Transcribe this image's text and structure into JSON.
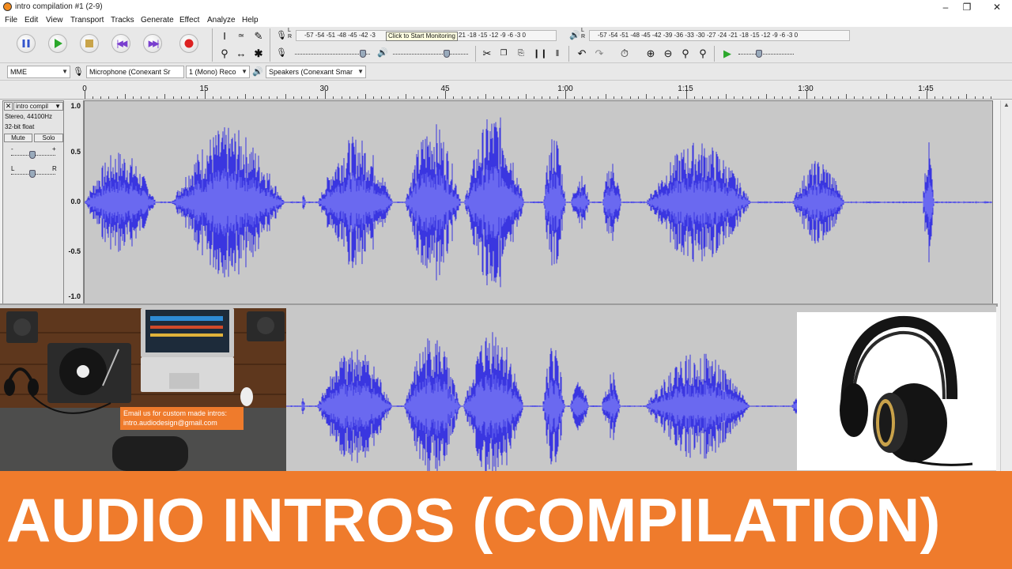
{
  "window": {
    "title": "intro compilation #1 (2-9)",
    "minimize_label": "–",
    "maximize_label": "❐",
    "close_label": "✕"
  },
  "menu": [
    "File",
    "Edit",
    "View",
    "Transport",
    "Tracks",
    "Generate",
    "Effect",
    "Analyze",
    "Help"
  ],
  "transport": {
    "buttons": [
      "pause-icon",
      "play-icon",
      "stop-icon",
      "skip-to-start-icon",
      "skip-to-end-icon",
      "record-icon"
    ]
  },
  "meters": {
    "record_channels": "L\nR",
    "record_scale": "-57 -54 -51 -48 -45 -42 -3",
    "record_scale_tail": "21 -18 -15 -12  -9  -6  -3  0",
    "monitor_tooltip": "Click to Start Monitoring",
    "playback_scale": "-57 -54 -51 -48 -45 -42 -39 -36 -33 -30 -27 -24 -21 -18 -15 -12  -9  -6  -3  0"
  },
  "devices": {
    "host": "MME",
    "input": "Microphone (Conexant Sr",
    "channels": "1 (Mono) Reco",
    "output": "Speakers (Conexant Smar"
  },
  "ruler": {
    "labels": [
      "0",
      "15",
      "30",
      "45",
      "1:00",
      "1:15",
      "1:30",
      "1:45"
    ]
  },
  "track": {
    "name": "intro compil",
    "format": "Stereo, 44100Hz",
    "bits": "32-bit float",
    "mute_label": "Mute",
    "solo_label": "Solo",
    "gain_minus": "-",
    "gain_plus": "+",
    "pan_left": "L",
    "pan_right": "R",
    "scale_labels": [
      "1.0",
      "0.5",
      "0.0",
      "-0.5",
      "-1.0"
    ]
  },
  "overlay": {
    "email_line1": "Email us for custom made intros:",
    "email_line2": "intro.audiodesign@gmail.com",
    "banner": "AUDIO INTROS (COMPILATION)"
  },
  "colors": {
    "waveform": "#3a36e0",
    "waveform_rms": "#6a69f0",
    "banner": "#ef7b2c"
  }
}
